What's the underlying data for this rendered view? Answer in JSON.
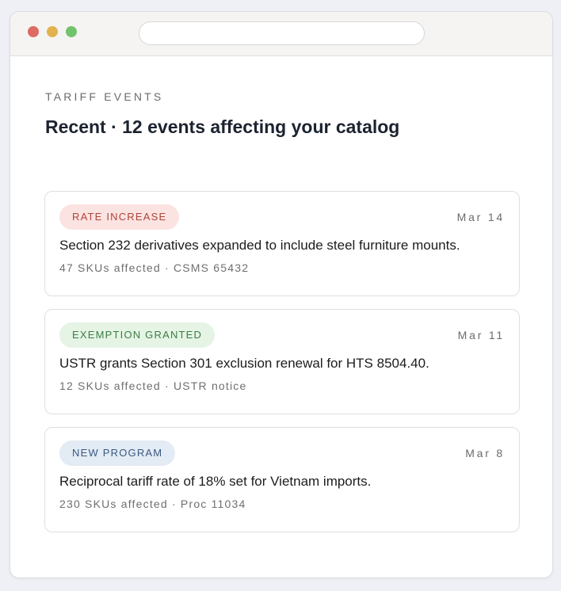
{
  "section": {
    "eyebrow": "TARIFF EVENTS",
    "heading": "Recent · 12 events affecting your catalog"
  },
  "events": [
    {
      "badge": "RATE INCREASE",
      "badge_color": "#b0453b",
      "date": "Mar 14",
      "title": "Section 232 derivatives expanded to include steel furniture mounts.",
      "meta": "47 SKUs affected · CSMS 65432"
    },
    {
      "badge": "EXEMPTION GRANTED",
      "badge_color": "#3d7d43",
      "date": "Mar 11",
      "title": "USTR grants Section 301 exclusion renewal for HTS 8504.40.",
      "meta": "12 SKUs affected · USTR notice"
    },
    {
      "badge": "NEW PROGRAM",
      "badge_color": "#3a5a82",
      "date": "Mar 8",
      "title": "Reciprocal tariff rate of 18% set for Vietnam imports.",
      "meta": "230 SKUs affected · Proc 11034"
    }
  ]
}
